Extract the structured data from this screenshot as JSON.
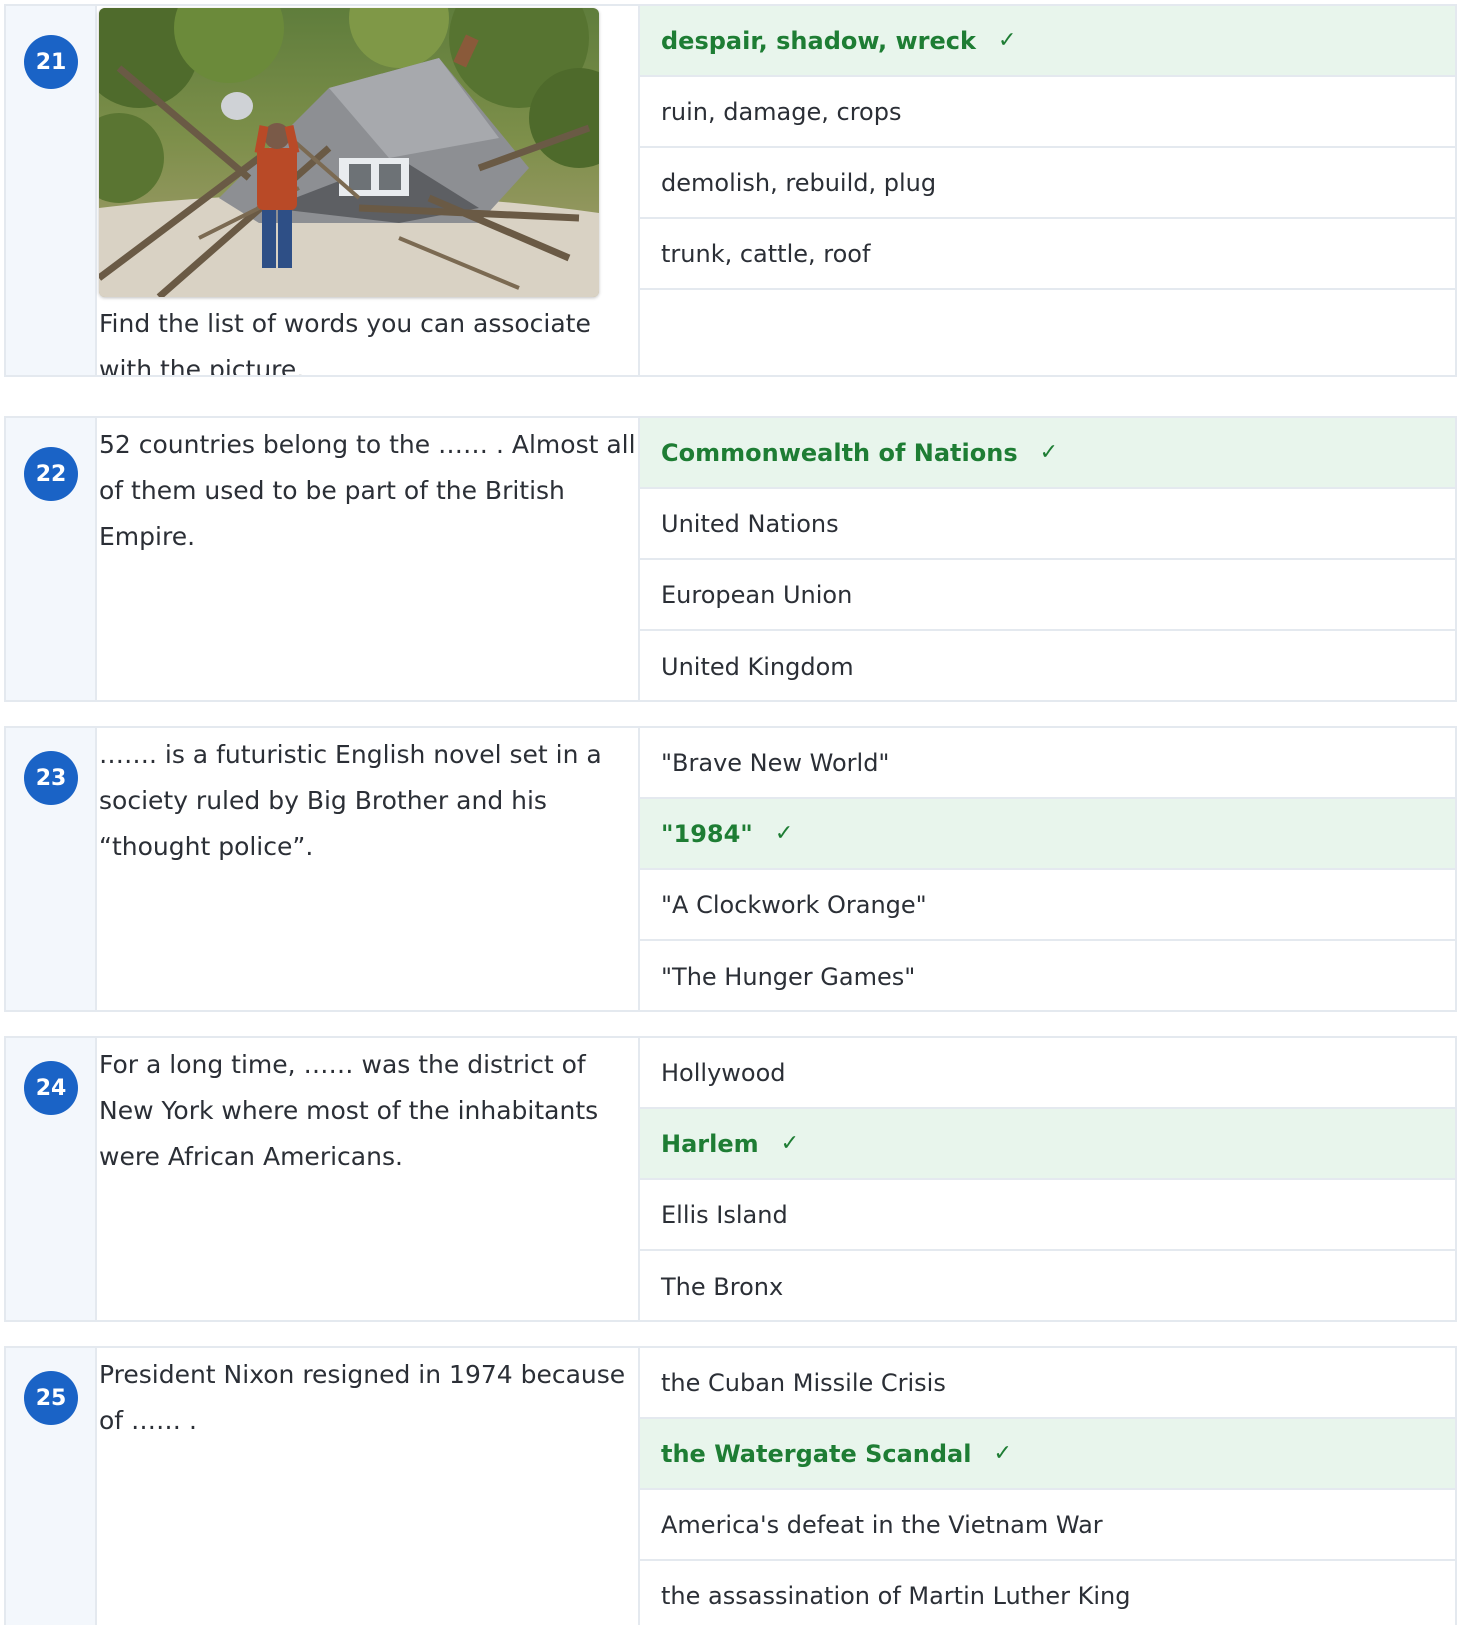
{
  "questions": [
    {
      "number": "21",
      "stem": "Find the list of words you can associate with the picture.",
      "image": "wrecked-house-photo",
      "options": [
        {
          "label": "despair, shadow, wreck",
          "correct": true
        },
        {
          "label": "ruin, damage, crops",
          "correct": false
        },
        {
          "label": "demolish, rebuild, plug",
          "correct": false
        },
        {
          "label": "trunk, cattle, roof",
          "correct": false
        }
      ]
    },
    {
      "number": "22",
      "stem": "52 countries belong to the …… . Almost all of them used to be part of the British Empire.",
      "options": [
        {
          "label": "Commonwealth of Nations",
          "correct": true
        },
        {
          "label": "United Nations",
          "correct": false
        },
        {
          "label": "European Union",
          "correct": false
        },
        {
          "label": "United Kingdom",
          "correct": false
        }
      ]
    },
    {
      "number": "23",
      "stem": "……. is a futuristic English novel set in a society ruled by Big Brother and his “thought police”.",
      "options": [
        {
          "label": "\"Brave New World\"",
          "correct": false
        },
        {
          "label": "\"1984\"",
          "correct": true
        },
        {
          "label": "\"A Clockwork Orange\"",
          "correct": false
        },
        {
          "label": "\"The Hunger Games\"",
          "correct": false
        }
      ]
    },
    {
      "number": "24",
      "stem": "For a long time, …… was the district of New York where most of the inhabitants were African Americans.",
      "options": [
        {
          "label": "Hollywood",
          "correct": false
        },
        {
          "label": "Harlem",
          "correct": true
        },
        {
          "label": "Ellis Island",
          "correct": false
        },
        {
          "label": "The Bronx",
          "correct": false
        }
      ]
    },
    {
      "number": "25",
      "stem": "President Nixon resigned in 1974 because of …… .",
      "options": [
        {
          "label": "the Cuban Missile Crisis",
          "correct": false
        },
        {
          "label": "the Watergate Scandal",
          "correct": true
        },
        {
          "label": "America's defeat in the Vietnam War",
          "correct": false
        },
        {
          "label": "the assassination of Martin Luther King",
          "correct": false
        }
      ]
    }
  ],
  "check_mark": "✓",
  "colors": {
    "badge": "#1a63c6",
    "correct_bg": "#e8f5ec",
    "correct_text": "#1e7d34",
    "border": "#e4e9ef",
    "number_column": "#f3f7fc"
  }
}
